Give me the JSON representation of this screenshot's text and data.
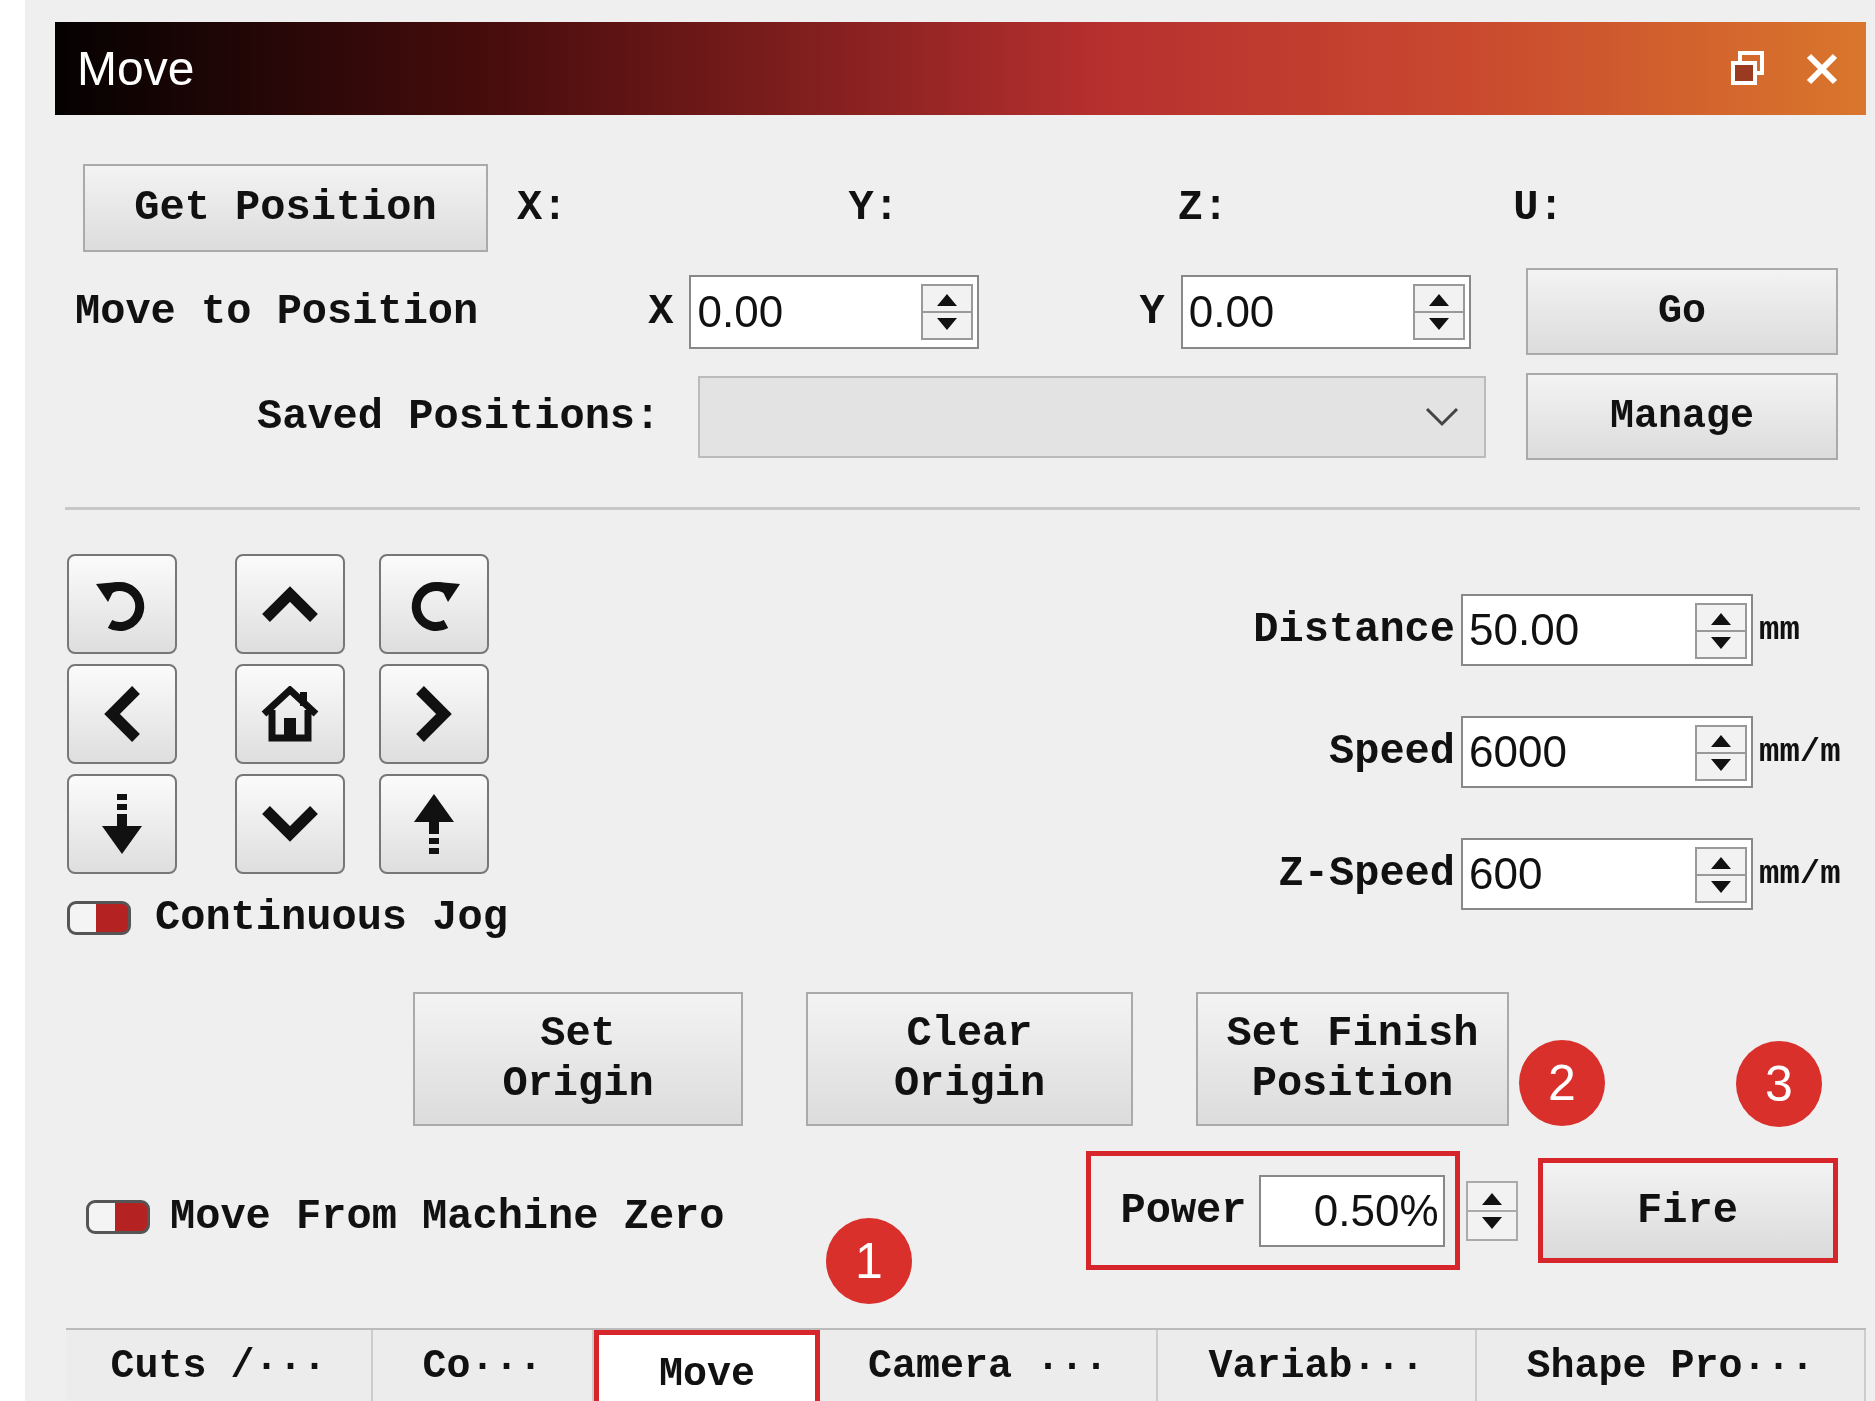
{
  "window": {
    "title": "Move"
  },
  "get_position": {
    "button": "Get Position",
    "axes": [
      "X:",
      "Y:",
      "Z:",
      "U:"
    ]
  },
  "move_to": {
    "label": "Move to Position",
    "fields": [
      {
        "axis": "X",
        "value": "0.00"
      },
      {
        "axis": "Y",
        "value": "0.00"
      }
    ],
    "button": "Go"
  },
  "saved_positions": {
    "label": "Saved Positions:",
    "button": "Manage"
  },
  "jog_buttons": [
    {
      "kind": "rotate-left"
    },
    {
      "kind": "up"
    },
    {
      "kind": "rotate-right"
    },
    {
      "kind": "left"
    },
    {
      "kind": "home"
    },
    {
      "kind": "right"
    },
    {
      "kind": "z-down"
    },
    {
      "kind": "down"
    },
    {
      "kind": "z-up"
    }
  ],
  "continuous_jog": {
    "label": "Continuous Jog",
    "on": false
  },
  "parameters": [
    {
      "label": "Distance",
      "value": "50.00",
      "unit": "mm"
    },
    {
      "label": "Speed",
      "value": "6000",
      "unit": "mm/m"
    },
    {
      "label": "Z-Speed",
      "value": "600",
      "unit": "mm/m"
    }
  ],
  "action_buttons": [
    "Set Origin",
    "Clear Origin",
    "Set Finish Position"
  ],
  "machine_zero": {
    "label": "Move From Machine Zero",
    "on": false
  },
  "power": {
    "label": "Power",
    "value": "0.50%",
    "highlighted": true
  },
  "fire": {
    "label": "Fire",
    "highlighted": true
  },
  "callouts": [
    "1",
    "2",
    "3"
  ],
  "tabs": [
    {
      "label": "Cuts /···",
      "selected": false,
      "highlighted": false
    },
    {
      "label": "Co···",
      "selected": false,
      "highlighted": false
    },
    {
      "label": "Move",
      "selected": true,
      "highlighted": true
    },
    {
      "label": "Camera ···",
      "selected": false,
      "highlighted": false
    },
    {
      "label": "Variab···",
      "selected": false,
      "highlighted": false
    },
    {
      "label": "Shape Pro···",
      "selected": false,
      "highlighted": false
    }
  ]
}
